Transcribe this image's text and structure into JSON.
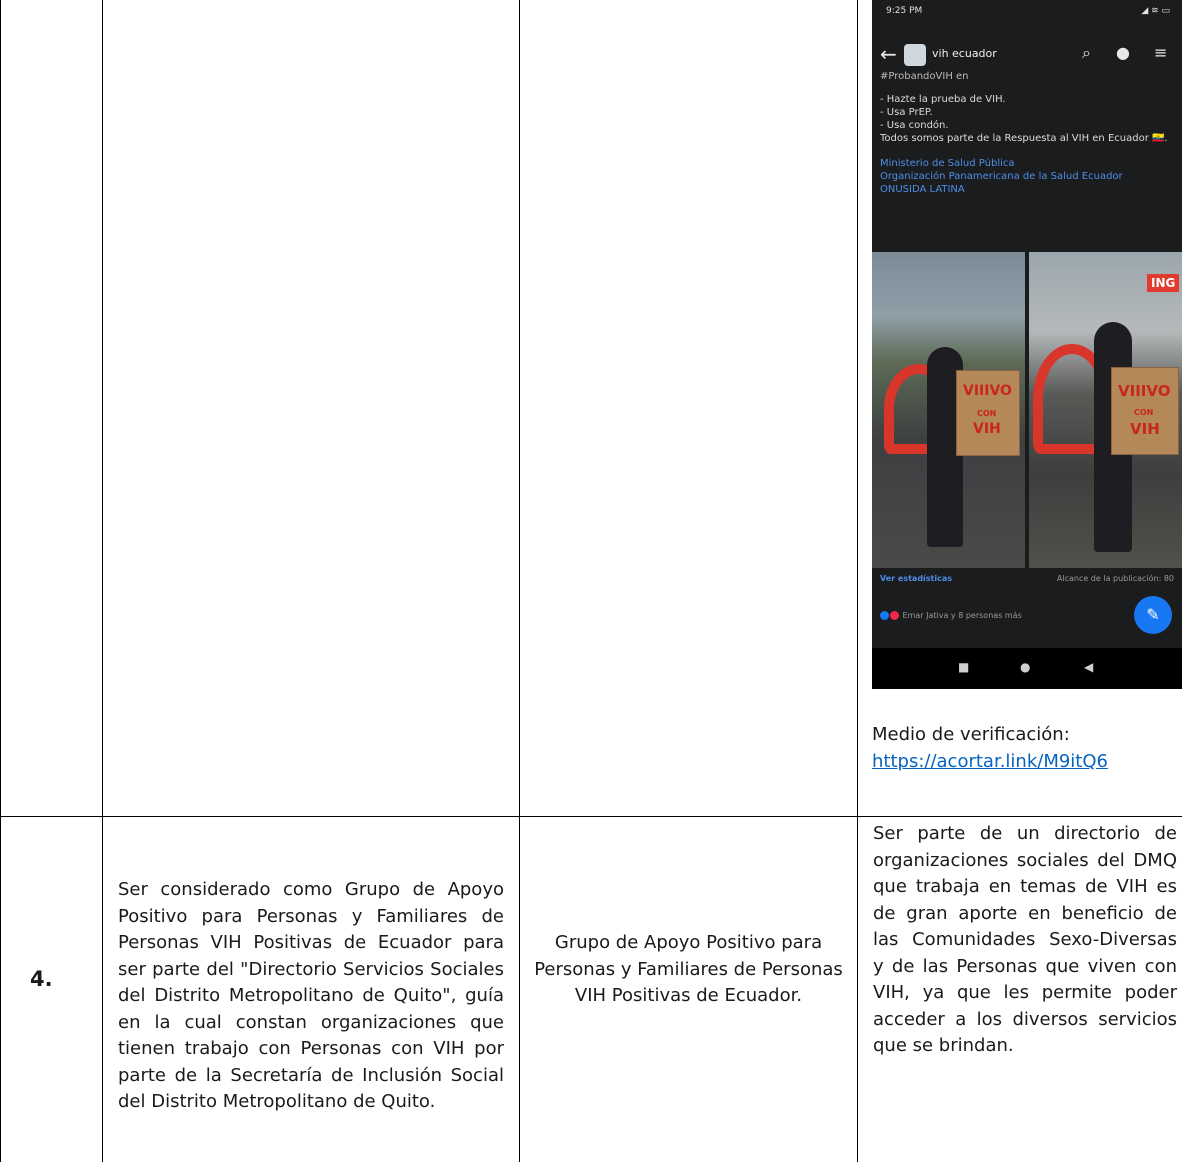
{
  "row4": {
    "number": "4.",
    "activity": "Ser considerado como Grupo de Apoyo Positivo para Personas y Familiares de Personas VIH Positivas de Ecuador para ser parte del \"Directorio Servicios Sociales del Distrito Metropolitano de Quito\", guía en la cual constan organizaciones que tienen trabajo con Personas con VIH por parte de la Secretaría de Inclusión Social del Distrito Metropolitano de Quito.",
    "organization": "Grupo de Apoyo Positivo para Personas y Familiares de Personas VIH Positivas de Ecuador.",
    "result": "Ser parte de un directorio de organizaciones sociales del DMQ que trabaja en temas de VIH es de gran aporte en beneficio de las Comunidades Sexo-Diversas y de las Personas que viven con VIH, ya que les permite poder acceder a los diversos servicios que se brindan."
  },
  "verification": {
    "label": "Medio de verificación:",
    "link": "https://acortar.link/M9itQ6"
  },
  "screenshot": {
    "status_time": "9:25 PM",
    "status_icons": "◢ ≋ ▭",
    "page_name": "vih ecuador",
    "post_partial": "#ProbandoVIH en ",
    "post_lines": [
      "- Hazte la prueba de VIH.",
      "- Usa PrEP.",
      "- Usa condón.",
      "Todos somos parte de la Respuesta al VIH en Ecuador 🇪🇨."
    ],
    "tags": [
      "Ministerio de Salud Pública",
      "Organización Panamericana de la Salud Ecuador",
      "ONUSIDA LATINA"
    ],
    "sign_text_1": "VIIIVO",
    "sign_text_2": "CON",
    "sign_text_3": "VIH",
    "store_text": "ING",
    "stats_link": "Ver estadísticas",
    "reach": "Alcance de la publicación: 80",
    "reactions": "Emar Jativa y 8 personas más",
    "colors": {
      "fab": "#1877f2",
      "link": "#0563c1"
    }
  }
}
